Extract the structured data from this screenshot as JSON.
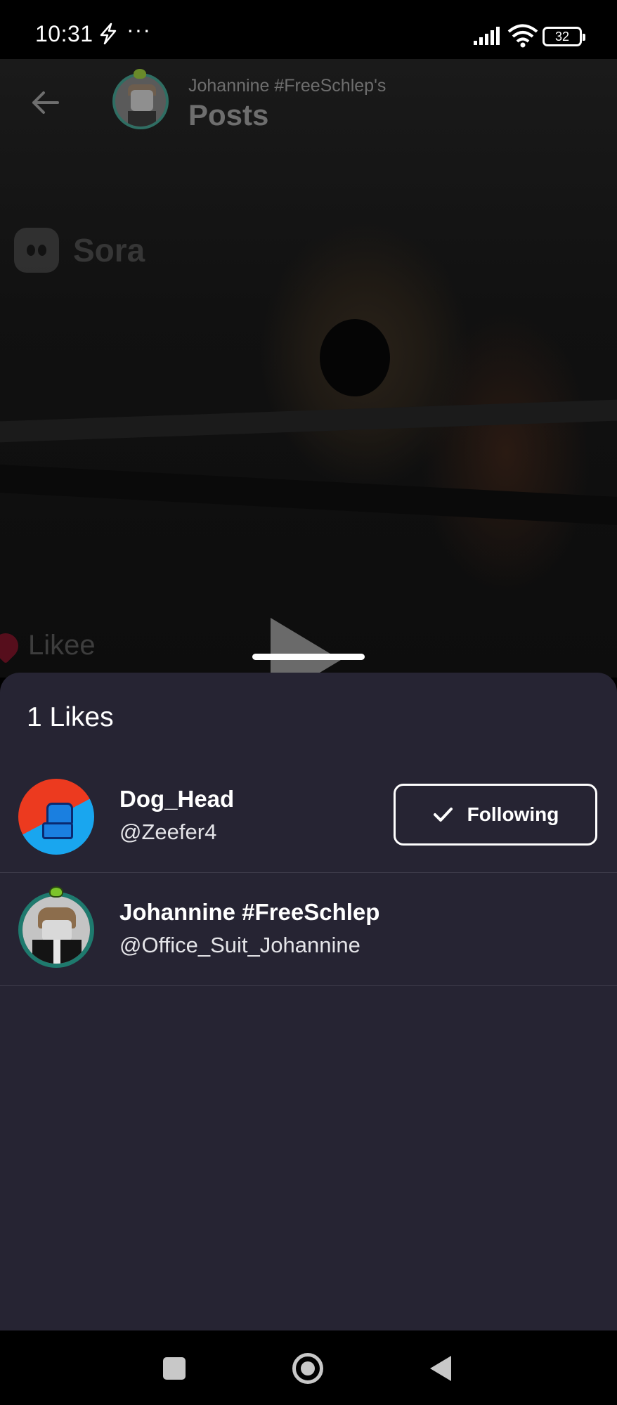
{
  "status_bar": {
    "time": "10:31",
    "overflow": "···",
    "battery": "32",
    "icons": [
      "bolt-icon",
      "signal-icon",
      "wifi-icon",
      "battery-icon"
    ]
  },
  "post_header": {
    "subtitle": "Johannine #FreeSchlep's",
    "title": "Posts"
  },
  "watermarks": {
    "sora": "Sora",
    "likee": "Likee"
  },
  "likes_sheet": {
    "title": "1 Likes",
    "users": [
      {
        "display_name": "Dog_Head",
        "handle": "@Zeefer4",
        "follow_label": "Following"
      },
      {
        "display_name": "Johannine #FreeSchlep",
        "handle": "@Office_Suit_Johannine"
      }
    ]
  },
  "colors": {
    "sheet_background": "#262433",
    "page_background": "#000000",
    "text": "#ffffff",
    "avatar_ring": "#1e7a6e"
  }
}
